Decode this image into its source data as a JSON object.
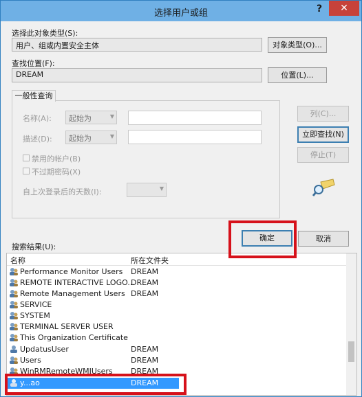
{
  "window": {
    "title": "选择用户或组",
    "help_label": "?",
    "close_label": "✕"
  },
  "object_type": {
    "label": "选择此对象类型(S):",
    "value": "用户、组或内置安全主体",
    "button": "对象类型(O)..."
  },
  "location": {
    "label": "查找位置(F):",
    "value": "DREAM",
    "button": "位置(L)..."
  },
  "general_query": {
    "tab": "一般性查询",
    "name_label": "名称(A):",
    "name_mode": "起始为",
    "desc_label": "描述(D):",
    "desc_mode": "起始为",
    "disabled_accounts": "禁用的帐户(B)",
    "non_expiring_pwd": "不过期密码(X)",
    "days_label": "自上次登录后的天数(I):"
  },
  "side_buttons": {
    "columns": "列(C)...",
    "find_now": "立即查找(N)",
    "stop": "停止(T)"
  },
  "ok_label": "确定",
  "cancel_label": "取消",
  "results": {
    "label": "搜索结果(U):",
    "col_name": "名称",
    "col_folder": "所在文件夹",
    "rows": [
      {
        "name": "Performance Monitor Users",
        "folder": "DREAM"
      },
      {
        "name": "REMOTE INTERACTIVE LOGO...",
        "folder": "DREAM"
      },
      {
        "name": "Remote Management Users",
        "folder": "DREAM"
      },
      {
        "name": "SERVICE",
        "folder": ""
      },
      {
        "name": "SYSTEM",
        "folder": ""
      },
      {
        "name": "TERMINAL SERVER USER",
        "folder": ""
      },
      {
        "name": "This Organization Certificate",
        "folder": ""
      },
      {
        "name": "UpdatusUser",
        "folder": "DREAM"
      },
      {
        "name": "Users",
        "folder": "DREAM"
      },
      {
        "name": "WinRMRemoteWMIUsers__",
        "folder": "DREAM"
      },
      {
        "name": "y...ao",
        "folder": "DREAM"
      }
    ]
  },
  "colors": {
    "title_bar": "#6fb0e5",
    "close": "#c7423a",
    "highlight": "#d6111a",
    "selection": "#3399ff"
  }
}
